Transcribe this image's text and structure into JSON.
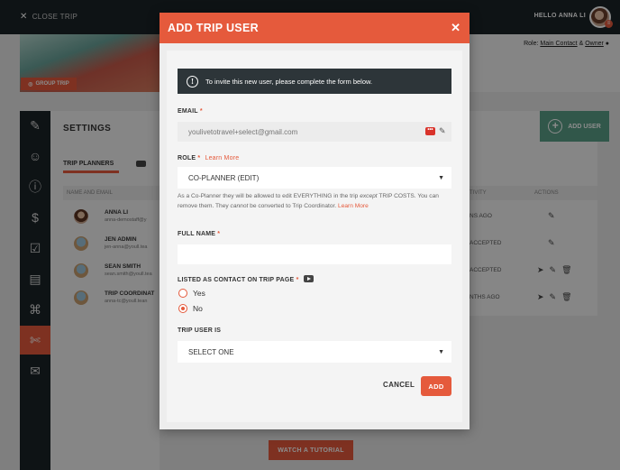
{
  "topbar": {
    "close_label": "CLOSE TRIP",
    "greeting": "HELLO ANNA LI"
  },
  "hero": {
    "group_badge": "GROUP TRIP",
    "role_prefix": "Role: ",
    "role_main": "Main Contact",
    "role_amp": " & ",
    "role_owner": "Owner"
  },
  "settings": {
    "title": "SETTINGS",
    "tab": "TRIP PLANNERS",
    "col_name": "NAME AND EMAIL",
    "col_activity": "TIVITY",
    "col_actions": "ACTIONS",
    "add_user": "ADD USER"
  },
  "rows": [
    {
      "name": "ANNA LI",
      "email": "anna-demostaff@y",
      "activity": "NS AGO"
    },
    {
      "name": "JEN ADMIN",
      "email": "jen-anna@youll.tea",
      "activity": "ACCEPTED"
    },
    {
      "name": "SEAN SMITH",
      "email": "sean.smith@youll.tea",
      "activity": "ACCEPTED"
    },
    {
      "name": "TRIP COORDINAT",
      "email": "anna-tc@youll.tean",
      "activity": "NTHS AGO"
    }
  ],
  "tutorial": "WATCH A TUTORIAL",
  "modal": {
    "title": "ADD TRIP USER",
    "notice": "To invite this new user, please complete the form below.",
    "email_label": "EMAIL",
    "email_placeholder": "youlivetotravel+select@gmail.com",
    "role_label": "ROLE",
    "learn_more": "Learn More",
    "role_value": "CO-PLANNER (EDIT)",
    "role_desc_1": "As a Co-Planner they will be allowed to edit EVERYTHING in the trip ",
    "role_desc_except": "except",
    "role_desc_2": " TRIP COSTS. You can remove them. They ",
    "role_desc_cannot": "cannot",
    "role_desc_3": " be converted to Trip Coordinator. ",
    "full_name_label": "FULL NAME",
    "full_name_value": "",
    "contact_label": "LISTED AS CONTACT ON TRIP PAGE",
    "yes_label": "Yes",
    "no_label": "No",
    "selected_contact": "No",
    "trip_user_label": "TRIP USER IS",
    "trip_user_value": "SELECT ONE",
    "cancel_label": "CANCEL",
    "add_label": "ADD",
    "req_mark": "*"
  },
  "colors": {
    "accent": "#e55a3c",
    "dark": "#1b2327",
    "green": "#5a9e87"
  },
  "icons": {
    "close": "close-icon",
    "info": "info-icon",
    "pen": "pencil-icon",
    "caret": "caret-down-icon",
    "video": "video-icon"
  }
}
